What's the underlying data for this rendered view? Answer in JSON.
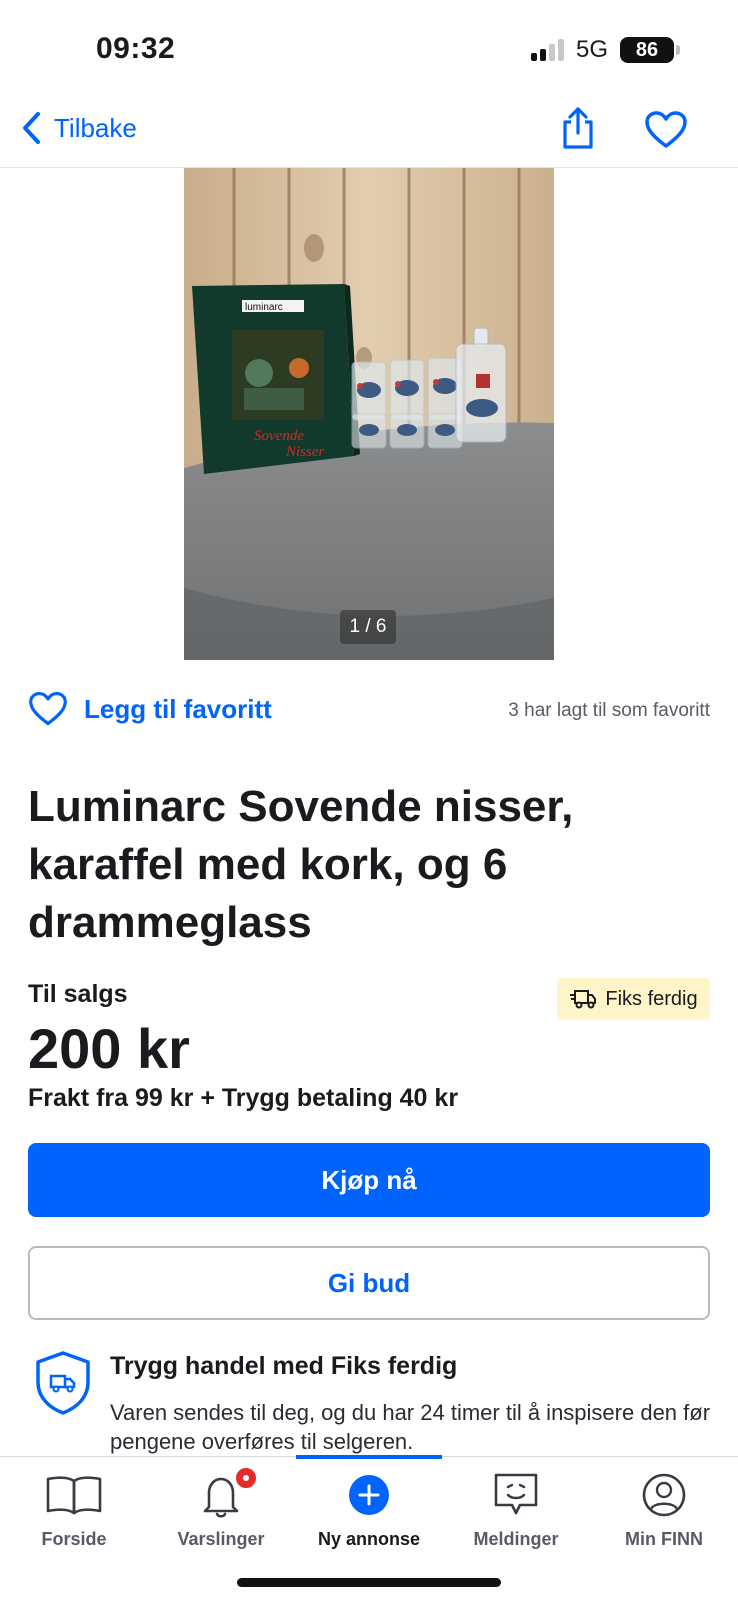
{
  "status_bar": {
    "time": "09:32",
    "network": "5G",
    "battery": "86"
  },
  "nav": {
    "back_label": "Tilbake"
  },
  "gallery": {
    "counter": "1 / 6"
  },
  "favorite": {
    "label": "Legg til favoritt",
    "count_text": "3 har lagt til som favoritt"
  },
  "listing": {
    "title": "Luminarc Sovende nisser, karaffel med kork,  og 6 drammeglass",
    "sale_type": "Til salgs",
    "badge": "Fiks ferdig",
    "price": "200 kr",
    "shipping": "Frakt fra 99 kr + Trygg betaling 40 kr",
    "buy_label": "Kjøp nå",
    "bid_label": "Gi bud"
  },
  "safe_trade": {
    "title": "Trygg handel med Fiks ferdig",
    "text": "Varen sendes til deg, og du har 24 timer til å inspisere den før pengene overføres til selgeren."
  },
  "photo": {
    "box_brand": "luminarc",
    "box_title_line1": "Sovende",
    "box_title_line2": "Nisser"
  },
  "tabs": [
    {
      "label": "Forside",
      "icon": "book-icon"
    },
    {
      "label": "Varslinger",
      "icon": "bell-icon"
    },
    {
      "label": "Ny annonse",
      "icon": "plus-circle-icon"
    },
    {
      "label": "Meldinger",
      "icon": "chat-icon"
    },
    {
      "label": "Min FINN",
      "icon": "profile-icon"
    }
  ],
  "colors": {
    "accent": "#0063fb",
    "badge_bg": "#fff5c8",
    "notification": "#e32b2b"
  }
}
